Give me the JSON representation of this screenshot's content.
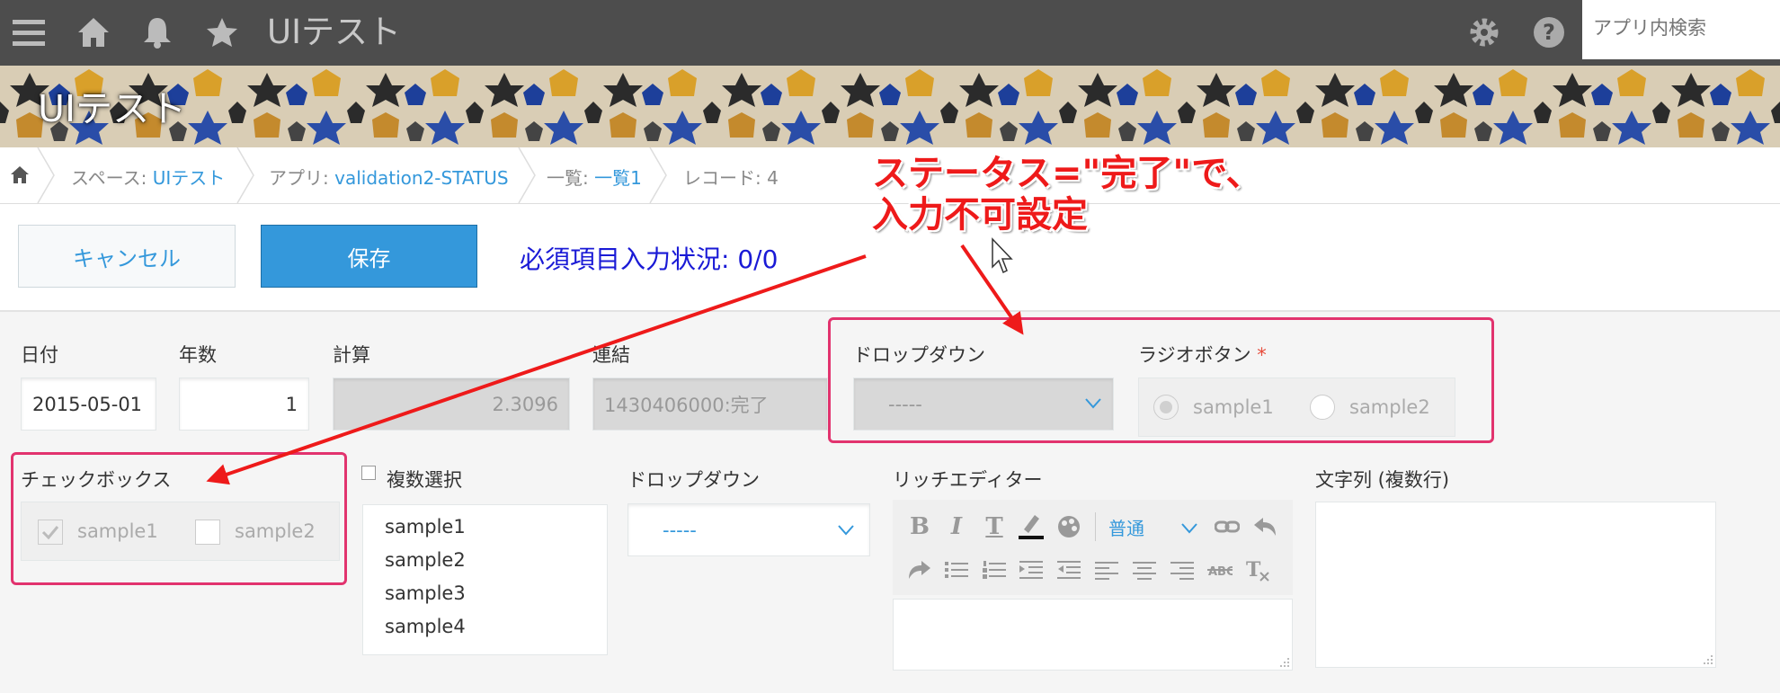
{
  "header": {
    "app_title": "UIテスト",
    "search_placeholder": "アプリ内検索",
    "icons": [
      "menu-icon",
      "home-icon",
      "bell-icon",
      "star-icon",
      "gear-icon",
      "help-icon"
    ]
  },
  "banner": {
    "title": "UIテスト"
  },
  "breadcrumb": {
    "space_prefix": "スペース: ",
    "space_link": "UIテスト",
    "app_prefix": "アプリ: ",
    "app_link": "validation2-STATUS",
    "list_prefix": "一覧: ",
    "list_link": "一覧1",
    "record": "レコード: 4"
  },
  "actions": {
    "cancel_label": "キャンセル",
    "save_label": "保存",
    "required_status": "必須項目入力状況: 0/0"
  },
  "fields": {
    "date": {
      "label": "日付",
      "value": "2015-05-01"
    },
    "years": {
      "label": "年数",
      "value": "1"
    },
    "calc": {
      "label": "計算",
      "value": "2.3096"
    },
    "concat": {
      "label": "連結",
      "value": "1430406000:完了"
    },
    "dropdown1": {
      "label": "ドロップダウン",
      "value": "-----"
    },
    "radio": {
      "label": "ラジオボタン",
      "required_mark": "*",
      "options": [
        "sample1",
        "sample2"
      ]
    },
    "checkbox": {
      "label": "チェックボックス",
      "options": [
        "sample1",
        "sample2"
      ],
      "checked": [
        true,
        false
      ]
    },
    "multiselect": {
      "label": "複数選択",
      "options": [
        "sample1",
        "sample2",
        "sample3",
        "sample4"
      ]
    },
    "dropdown2": {
      "label": "ドロップダウン",
      "value": "-----"
    },
    "richtext": {
      "label": "リッチエディター",
      "font_size": "普通"
    },
    "multiline": {
      "label": "文字列 (複数行)"
    }
  },
  "annotation": {
    "line1": "ステータス=\"完了\"で、",
    "line2": "入力不可設定"
  },
  "colors": {
    "accent": "#3498db",
    "header_bg": "#4d4d4d",
    "annotation": "#ee1a1a",
    "highlight_box": "#e2336e"
  }
}
